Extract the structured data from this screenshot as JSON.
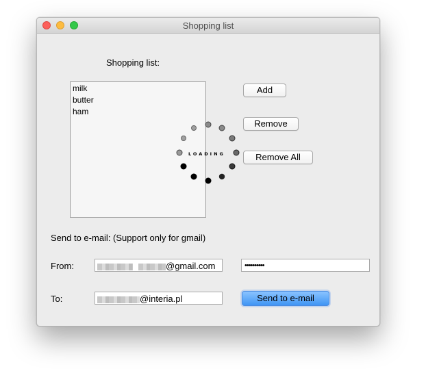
{
  "window": {
    "title": "Shopping list"
  },
  "list": {
    "heading": "Shopping list:",
    "items": [
      "milk",
      "butter",
      "ham"
    ]
  },
  "buttons": {
    "add": "Add",
    "remove": "Remove",
    "remove_all": "Remove All",
    "send": "Send to e-mail"
  },
  "loading": {
    "text": "LOADING"
  },
  "email": {
    "heading": "Send to e-mail: (Support only for gmail)",
    "from_label": "From:",
    "from_value_suffix": "@gmail.com",
    "password_value": "••••••••••",
    "to_label": "To:",
    "to_value_suffix": "@interia.pl"
  },
  "colors": {
    "accent": "#3f95f4",
    "window_bg": "#ececec"
  }
}
